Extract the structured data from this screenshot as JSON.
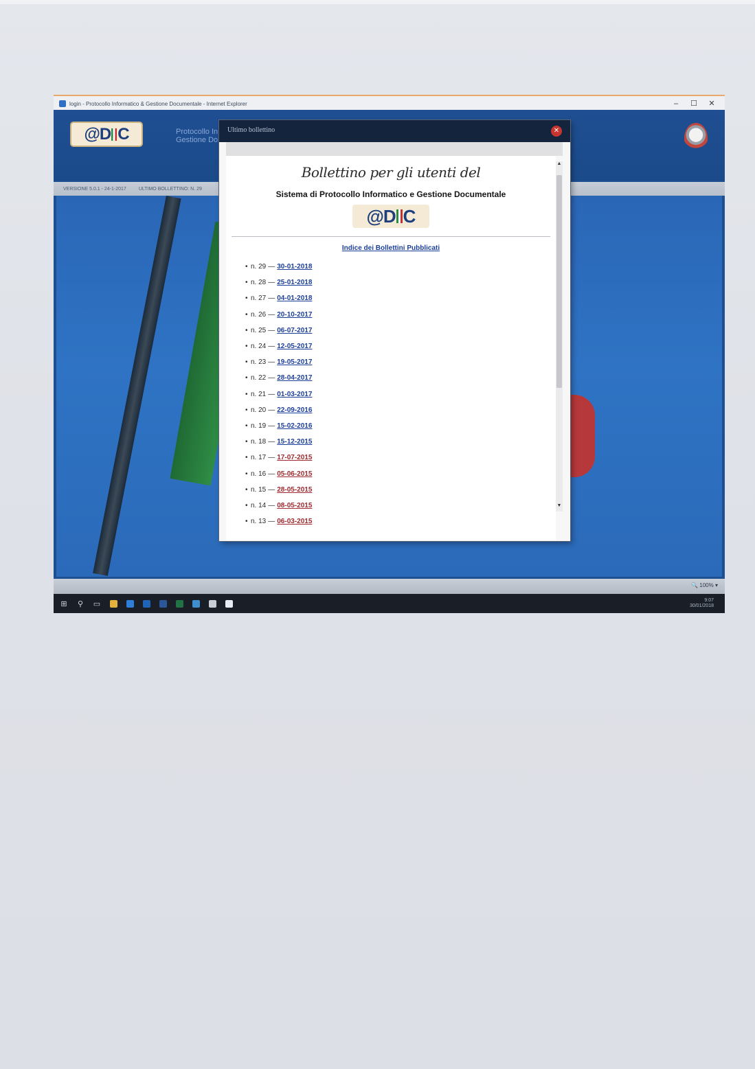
{
  "window": {
    "title": "login - Protocollo Informatico & Gestione Documentale - Internet Explorer",
    "controls": {
      "minimize": "–",
      "maximize": "☐",
      "close": "✕"
    }
  },
  "header": {
    "logo_left": "@D",
    "logo_right": "C",
    "subtitle_line1": "Protocollo In",
    "subtitle_line2": "Gestione Do"
  },
  "info_bar": {
    "version": "VERSIONE 5.0.1 - 24-1-2017",
    "last_bulletin": "ULTIMO BOLLETTINO: N. 29"
  },
  "modal": {
    "title": "Ultimo bollettino",
    "close_glyph": "✕",
    "heading": "Bollettino per gli utenti del",
    "subheading": "Sistema di Protocollo Informatico e Gestione Documentale",
    "logo_left": "@D",
    "logo_right": "C",
    "index_link": "Indice dei Bollettini Pubblicati",
    "bulletins": [
      {
        "num": "n. 29",
        "date": "30-01-2018",
        "style": "current"
      },
      {
        "num": "n. 28",
        "date": "25-01-2018",
        "style": "current"
      },
      {
        "num": "n. 27",
        "date": "04-01-2018",
        "style": "current"
      },
      {
        "num": "n. 26",
        "date": "20-10-2017",
        "style": "current"
      },
      {
        "num": "n. 25",
        "date": "06-07-2017",
        "style": "current"
      },
      {
        "num": "n. 24",
        "date": "12-05-2017",
        "style": "current"
      },
      {
        "num": "n. 23",
        "date": "19-05-2017",
        "style": "current"
      },
      {
        "num": "n. 22",
        "date": "28-04-2017",
        "style": "current"
      },
      {
        "num": "n. 21",
        "date": "01-03-2017",
        "style": "current"
      },
      {
        "num": "n. 20",
        "date": "22-09-2016",
        "style": "current"
      },
      {
        "num": "n. 19",
        "date": "15-02-2016",
        "style": "current"
      },
      {
        "num": "n. 18",
        "date": "15-12-2015",
        "style": "current"
      },
      {
        "num": "n. 17",
        "date": "17-07-2015",
        "style": "old"
      },
      {
        "num": "n. 16",
        "date": "05-06-2015",
        "style": "old"
      },
      {
        "num": "n. 15",
        "date": "28-05-2015",
        "style": "old"
      },
      {
        "num": "n. 14",
        "date": "08-05-2015",
        "style": "old"
      },
      {
        "num": "n. 13",
        "date": "06-03-2015",
        "style": "old"
      }
    ]
  },
  "status": {
    "zoom": "100%"
  },
  "tray": {
    "time": "9:07",
    "date": "30/01/2018"
  },
  "colors": {
    "header_blue": "#1d4f91",
    "modal_header": "#15243d",
    "link_blue": "#1c3f9a",
    "link_red": "#a02a2f",
    "close_red": "#c6352f"
  }
}
